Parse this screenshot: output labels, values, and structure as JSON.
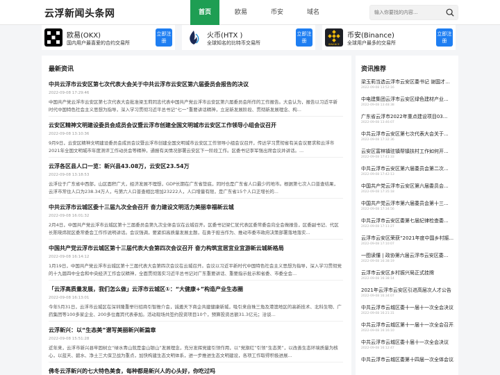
{
  "header": {
    "logo": "云浮新闻头条网",
    "nav": [
      {
        "label": "首页"
      },
      {
        "label": "欧易"
      },
      {
        "label": "币安"
      },
      {
        "label": "域名"
      }
    ],
    "search_placeholder": "输入你要找的内容..."
  },
  "exchanges": [
    {
      "name": "欧易(OKX)",
      "desc": "国内用户最喜爱的合约交易所",
      "button": "立即注册",
      "logo": "okx-logo"
    },
    {
      "name": "火币(HTX )",
      "desc": "全球知名的比特币交易所",
      "button": "立即注册",
      "logo": "htx-logo"
    },
    {
      "name": "币安(Binance)",
      "desc": "全球用户最多的交易所",
      "button": "立即注册",
      "logo": "binance-logo",
      "logo_text": "BINANCE"
    }
  ],
  "main": {
    "section_title": "最新资讯",
    "articles": [
      {
        "title": "中共云浮市云安区第七次代表大会关于中共云浮市云安区第六届委员会报告的决议",
        "date": "2022-09-08 17:29:46",
        "summary": "中国共产党云浮市云安区第七次代表大会批准梁玉莉同志代表中国共产党云浮市云安区第六届委员会所作的工作报告。大会认为，报告以习近平新时代中国特色社会主义思想为指导，深入学习贯彻习近平总书记“七一”重要讲话精神，立足新发展阶段、贯彻新发展理念、构..."
      },
      {
        "title": "云安区精神文明建设委员会成员会议暨云浮市创建全国文明城市云安区工作领导小组会议召开",
        "date": "2022-09-08 13:10:36",
        "summary": "9月9日，云安区精神文明建设委员会成员会议暨云浮市创建全国文明城市云安区工作领导小组会议召开，传达学习贯彻省有关会议要求和云浮市2021年全国文明城市年度测评工作动员会等精神，通报有关情况部署云安区下一阶段工作。区委书记李军强出席会议并讲话。..."
      },
      {
        "title": "云浮各区县人口一览：新兴县43.08万，云安区23.54万",
        "date": "2022-09-08 13:18:53",
        "summary": "云浮位于广东省中西部，山区面积广大，经济发展不理想，GDP长期在广东省垫底，同时也是广东省人口最少的地市。根据第七次人口普查结果，云浮市常住人口为238.34万人，与第六人口普查相比增加23222人，人口增量有限，是广东省15个人口正增长的..."
      },
      {
        "title": "中共云浮市云城区委十三届九次全会召开 奋力建设文明活力美丽幸福新云城",
        "date": "2022-09-08 16:01:32",
        "summary": "2月4日，中国共产党云浮市云城区第十三届委员会第九次全体会议在云城召开。区委书记梁仁犹代表区委常委会向全会做报告，区委副书记、代区长陈晓炜就区委常委会工作作说明讲话。会议强调，要紧扣高质量发展主题，在勇于担当作为、推动市委市政府决策部署落地落实..."
      },
      {
        "title": "中国共产党云浮市云城区第十三届代表大会第四次会议召开 奋力构筑宜居宜业宜游新云城新格局",
        "date": "2022-09-08 16:14:12",
        "summary": "1月19日，中国共产党云浮市云城区第十三届代表大会第四次会议在云城召开。会议以习近平新时代中国特色社会主义思想为指导，深入学习贯彻党的十九届四中全会和中央经济工作会议精神，全面贯彻落实习近平总书记对广东重要讲话、重要指示批示和省委、市委全会..."
      },
      {
        "title": "「云浮高质量发展，我们怎么做」云浮市云城区①：“大健康+”构造产业生态圈",
        "date": "2022-09-08 16:13:01",
        "summary": "今年5月31日，云浮市云城区在深圳隆重举行招商引智推介会，诚邀天下商企共建健康新城，吸引来自珠三角及港澳地区的高新技术、北科生物、广药集团等100多家企业、200多位嘉宾代表参加。活动现场共签约投资项目10个，预算投资总额31.3亿元；洽谈..."
      },
      {
        "title": "云浮新兴：以“生态美”谱写美丽新兴新篇章",
        "date": "2022-09-08 15:51:28",
        "summary": "近年来，云浮市新兴县牢固树立“绿水青山就是金山银山”发展理念，充分发挥党建引领作用，以“党旗红”引领“生态美”，以改善生态环境质量为核心，以蓝天、碧水、净土三大保卫战为重点，加快构建生态文明体系，进一步推进生态文明建设，各项工作取得积极进展..."
      },
      {
        "title": "佛冬云浮新兴的七大特色美食，每种都是新兴人的心头好，你吃过吗",
        "date": "",
        "summary": ""
      }
    ]
  },
  "sidebar": {
    "title": "资讯推荐",
    "items": [
      {
        "title": "梁玉莉当选云浮市云安区委书记 谢国才...",
        "date": "2022-09-08 13:52:16"
      },
      {
        "title": "中电建集团云浮市云安区绿色建材产业...",
        "date": "2022-09-08 13:48:38"
      },
      {
        "title": "广东省云浮市2022年重点建设项目03...",
        "date": "2022-09-08 13:46:07"
      },
      {
        "title": "中共云浮市云安区第七次代表大会关于...",
        "date": "2022-09-08 17:32:36"
      },
      {
        "title": "云安区富林镇驻镇帮镇扶村工作如何开...",
        "date": "2022-09-08 17:41:33"
      },
      {
        "title": "中共云浮市云安区第六届委员会第二次...",
        "date": "2022-09-08 17:42:13"
      },
      {
        "title": "中国共产党云浮市云安区第六届委员会...",
        "date": "2022-09-08 17:35:18"
      },
      {
        "title": "中国共产党云浮市第六届委员会第十三...",
        "date": "2022-09-08 17:34:56"
      },
      {
        "title": "中共云浮市云安区委第七届纪律检查委...",
        "date": "2022-09-08 17:11:27"
      },
      {
        "title": "云浮市云安区荣获“2021年度中国乡村振...",
        "date": "2022-09-08 17:10:07"
      },
      {
        "title": "一图读懂 | 政协第六届云浮市云安区委...",
        "date": "2022-09-08 16:38:19"
      },
      {
        "title": "云浮市云安区乡村振兴局正式挂牌",
        "date": "2022-09-08 16:38:14"
      },
      {
        "title": "2021年云浮市云安区引进高层次人才公告",
        "date": "2022-09-08 16:34:07"
      },
      {
        "title": "中共云浮市云城区委十一届十一次全会决议",
        "date": "2022-09-08 16:21:31"
      },
      {
        "title": "中共云浮市云城区第十一届十一次全会召开...",
        "date": "2022-09-08 16:16:10"
      },
      {
        "title": "中共云浮市云城区委十届十一次全会决议",
        "date": "2022-09-08 16:12:47"
      },
      {
        "title": "中共云浮市云城区委第十四届一次全体会议...",
        "date": ""
      }
    ]
  },
  "colors": {
    "accent_green": "#1e9e53",
    "button_blue": "#1e7ef2"
  }
}
